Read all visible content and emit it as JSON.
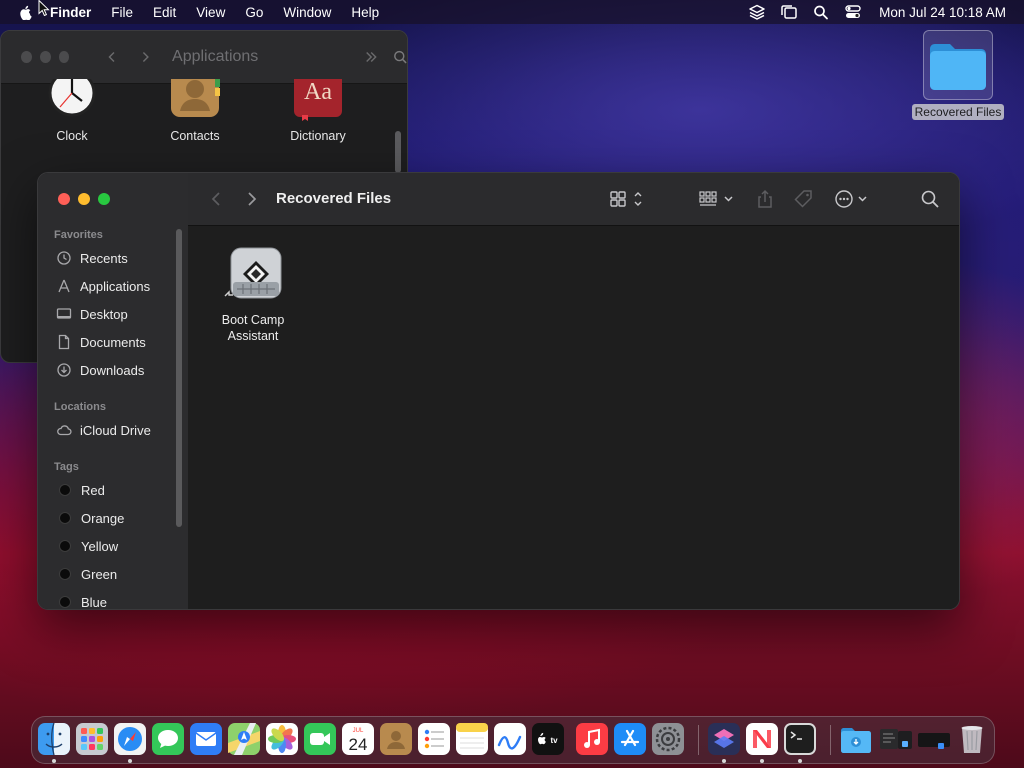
{
  "menubar": {
    "app": "Finder",
    "items": [
      "File",
      "Edit",
      "View",
      "Go",
      "Window",
      "Help"
    ],
    "clock": "Mon Jul 24  10:18 AM"
  },
  "back_window": {
    "title": "Applications",
    "apps": [
      {
        "label": "Clock",
        "icon": "clock-app-icon"
      },
      {
        "label": "Contacts",
        "icon": "contacts-app-icon"
      },
      {
        "label": "Dictionary",
        "icon": "dictionary-app-icon"
      }
    ],
    "dictionary_glyph": "Aa"
  },
  "desktop": {
    "folder_label": "Recovered Files"
  },
  "finder": {
    "title": "Recovered Files",
    "sidebar": {
      "favorites_header": "Favorites",
      "favorites": [
        "Recents",
        "Applications",
        "Desktop",
        "Documents",
        "Downloads"
      ],
      "locations_header": "Locations",
      "locations": [
        "iCloud Drive"
      ],
      "tags_header": "Tags",
      "tags": [
        "Red",
        "Orange",
        "Yellow",
        "Green",
        "Blue"
      ]
    },
    "files": [
      {
        "line1": "Boot Camp",
        "line2": "Assistant",
        "icon": "boot-camp-assistant-icon"
      }
    ]
  },
  "dock": {
    "calendar_month": "JUL",
    "calendar_day": "24",
    "tv_label": "tv",
    "apps": [
      "Finder",
      "Launchpad",
      "Safari",
      "Messages",
      "Mail",
      "Maps",
      "Photos",
      "FaceTime",
      "Calendar",
      "Contacts",
      "Reminders",
      "Notes",
      "Freeform",
      "TV",
      "Music",
      "App Store",
      "System Settings",
      "Shortcuts",
      "News",
      "Terminal",
      "Downloads",
      "Recent Windows",
      "Trash"
    ]
  },
  "colors": {
    "traffic_red": "#fe5f57",
    "traffic_yellow": "#febc2e",
    "traffic_green": "#28c840",
    "folder_blue": "#3fa9f5",
    "window_bg": "#1e1e1e",
    "sidebar_bg": "#2c2c2e"
  }
}
